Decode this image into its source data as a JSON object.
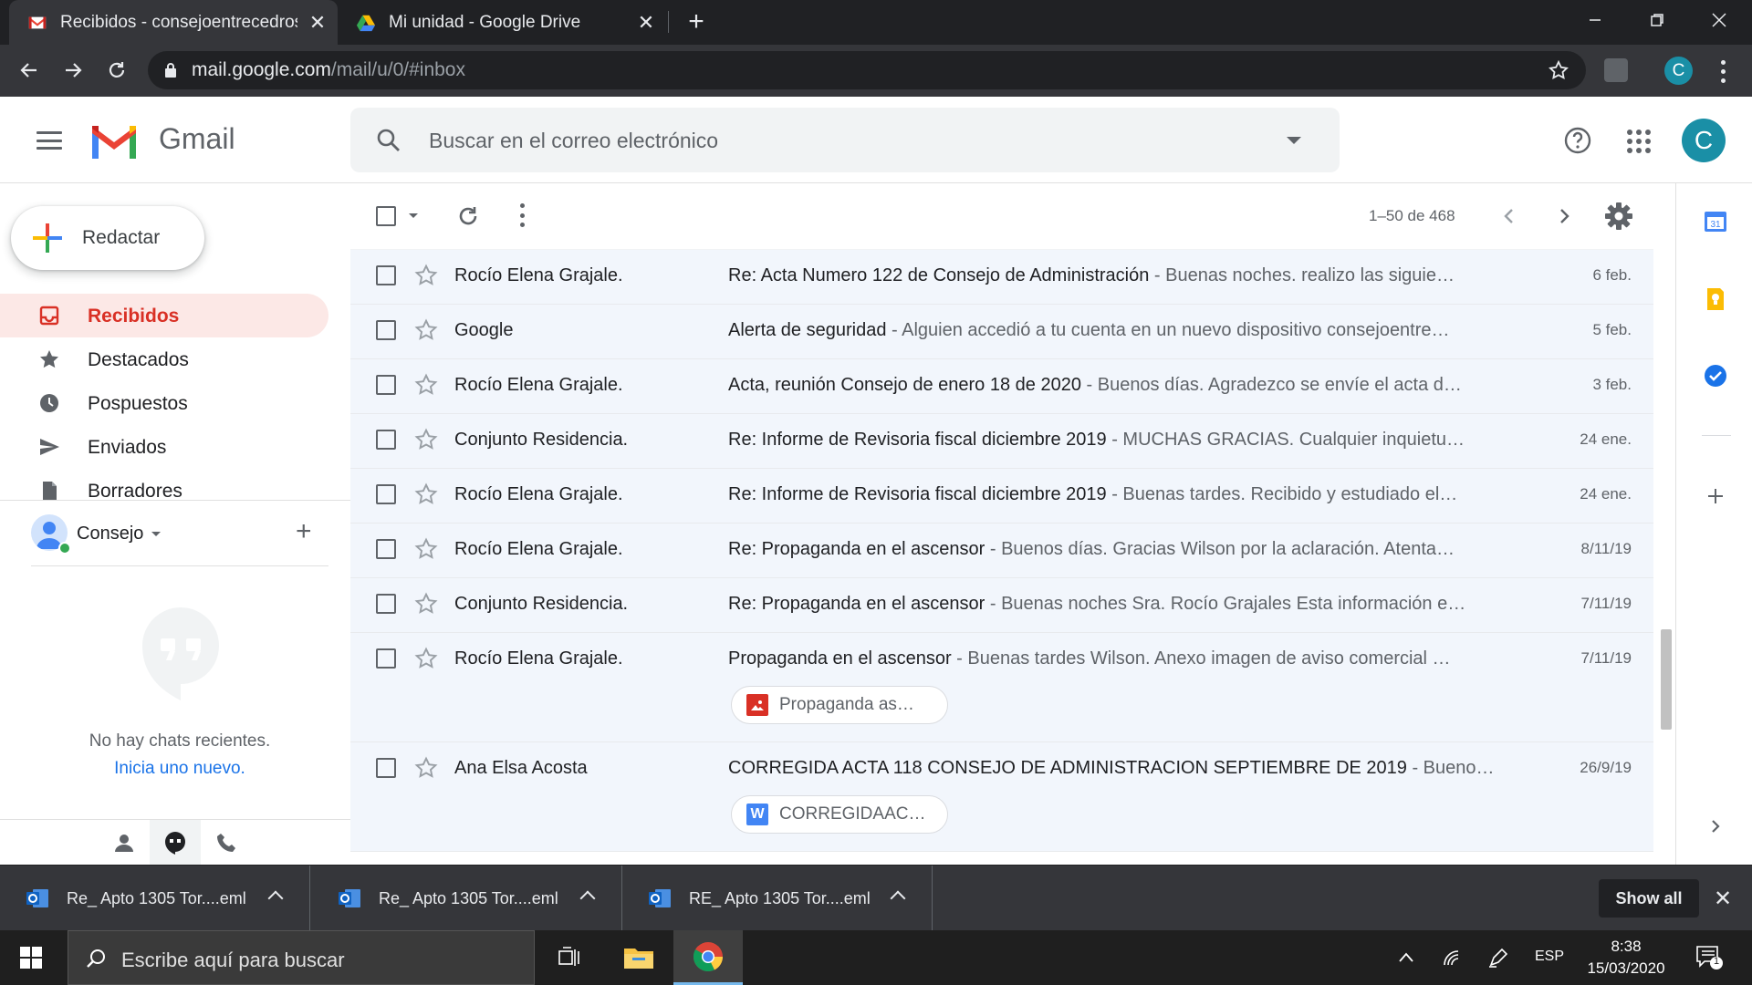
{
  "browser": {
    "tabs": [
      {
        "title": "Recibidos - consejoentrecedros@",
        "active": true,
        "favicon": "gmail-icon"
      },
      {
        "title": "Mi unidad - Google Drive",
        "active": false,
        "favicon": "drive-icon"
      }
    ],
    "url_host": "mail.google.com",
    "url_path": "/mail/u/0/#inbox",
    "profile_initial": "C"
  },
  "gmail": {
    "app_name": "Gmail",
    "search_placeholder": "Buscar en el correo electrónico",
    "account_initial": "C",
    "compose_label": "Redactar",
    "nav": [
      {
        "label": "Recibidos",
        "icon": "inbox-icon",
        "active": true
      },
      {
        "label": "Destacados",
        "icon": "star-icon",
        "active": false
      },
      {
        "label": "Pospuestos",
        "icon": "clock-icon",
        "active": false
      },
      {
        "label": "Enviados",
        "icon": "send-icon",
        "active": false
      },
      {
        "label": "Borradores",
        "icon": "draft-icon",
        "active": false
      }
    ],
    "chat": {
      "user": "Consejo",
      "no_chats": "No hay chats recientes.",
      "start_new": "Inicia uno nuevo."
    },
    "pager": "1–50 de 468",
    "emails": [
      {
        "from": "Rocío Elena Grajale.",
        "subject": "Re: Acta Numero 122 de Consejo de Administración",
        "snippet": " - Buenas noches. realizo las siguie…",
        "date": "6 feb."
      },
      {
        "from": "Google",
        "subject": "Alerta de seguridad",
        "snippet": " - Alguien accedió a tu cuenta en un nuevo dispositivo consejoentre…",
        "date": "5 feb."
      },
      {
        "from": "Rocío Elena Grajale.",
        "subject": "Acta, reunión Consejo de enero 18 de 2020",
        "snippet": " - Buenos días. Agradezco se envíe el acta d…",
        "date": "3 feb."
      },
      {
        "from": "Conjunto Residencia.",
        "subject": "Re: Informe de Revisoria fiscal diciembre 2019",
        "snippet": " - MUCHAS GRACIAS. Cualquier inquietu…",
        "date": "24 ene."
      },
      {
        "from": "Rocío Elena Grajale.",
        "subject": "Re: Informe de Revisoria fiscal diciembre 2019",
        "snippet": " - Buenas tardes. Recibido y estudiado el…",
        "date": "24 ene."
      },
      {
        "from": "Rocío Elena Grajale.",
        "subject": "Re: Propaganda en el ascensor",
        "snippet": " - Buenos días. Gracias Wilson por la aclaración. Atenta…",
        "date": "8/11/19"
      },
      {
        "from": "Conjunto Residencia.",
        "subject": "Re: Propaganda en el ascensor",
        "snippet": " - Buenas noches Sra. Rocío Grajales Esta información e…",
        "date": "7/11/19"
      },
      {
        "from": "Rocío Elena Grajale.",
        "subject": "Propaganda en el ascensor",
        "snippet": " - Buenas tardes Wilson. Anexo imagen de aviso comercial …",
        "date": "7/11/19",
        "attachment": {
          "name": "Propaganda as…",
          "icon": "image-icon"
        }
      },
      {
        "from": "Ana Elsa Acosta",
        "subject": "CORREGIDA ACTA 118 CONSEJO DE ADMINISTRACION SEPTIEMBRE DE 2019",
        "snippet": " - Bueno…",
        "date": "26/9/19",
        "attachment": {
          "name": "CORREGIDAAC…",
          "icon": "word-icon"
        }
      }
    ]
  },
  "downloads": {
    "items": [
      "Re_ Apto 1305 Tor....eml",
      "Re_ Apto 1305 Tor....eml",
      "RE_ Apto 1305 Tor....eml"
    ],
    "show_all": "Show all"
  },
  "taskbar": {
    "search_placeholder": "Escribe aquí para buscar",
    "language": "ESP",
    "time": "8:38",
    "date": "15/03/2020",
    "notifications": "1"
  },
  "colors": {
    "gmail_red": "#d93025",
    "active_nav_bg": "#fce8e6",
    "read_row_bg": "#f2f6fc",
    "chrome_dark": "#35363a"
  }
}
